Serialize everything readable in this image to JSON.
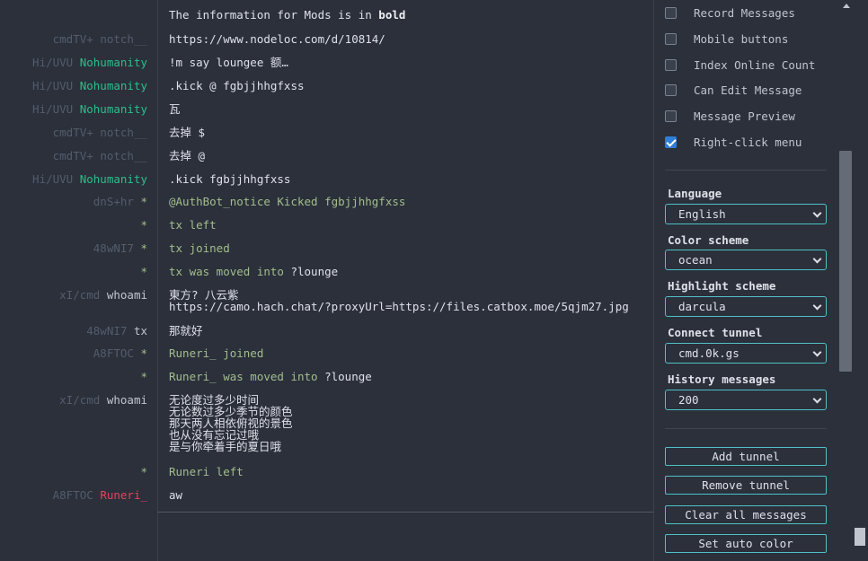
{
  "messages": [
    {
      "trip": "",
      "nick": "",
      "text_pre": "The information for Mods is in ",
      "text_bold": "bold",
      "kind": "mixed"
    },
    {
      "trip": "cmdTV+",
      "nick": "notch__",
      "nick_style": "dim",
      "text": "https://www.nodeloc.com/d/10814/",
      "kind": "normal"
    },
    {
      "trip": "Hi/UVU",
      "nick": "Nohumanity",
      "nick_style": "green",
      "text": "!m say loungee 额…",
      "kind": "normal"
    },
    {
      "trip": "Hi/UVU",
      "nick": "Nohumanity",
      "nick_style": "green",
      "text": ".kick @ fgbjjhhgfxss",
      "kind": "normal"
    },
    {
      "trip": "Hi/UVU",
      "nick": "Nohumanity",
      "nick_style": "green",
      "text": "瓦",
      "kind": "normal"
    },
    {
      "trip": "cmdTV+",
      "nick": "notch__",
      "nick_style": "dim",
      "text": "去掉 $",
      "kind": "normal"
    },
    {
      "trip": "cmdTV+",
      "nick": "notch__",
      "nick_style": "dim",
      "text": "去掉 @",
      "kind": "normal"
    },
    {
      "trip": "Hi/UVU",
      "nick": "Nohumanity",
      "nick_style": "green",
      "text": ".kick fgbjjhhgfxss",
      "kind": "normal"
    },
    {
      "trip": "dnS+hr",
      "nick": "*",
      "nick_style": "star",
      "text": "@AuthBot_notice Kicked fgbjjhhgfxss",
      "kind": "sys"
    },
    {
      "trip": "",
      "nick": "*",
      "nick_style": "star",
      "text": "tx left",
      "kind": "sys"
    },
    {
      "trip": "48wNI7",
      "nick": "*",
      "nick_style": "star",
      "text": "tx joined",
      "kind": "sys"
    },
    {
      "trip": "",
      "nick": "*",
      "nick_style": "star",
      "text_pre": "tx was moved into ",
      "text_hl": "?lounge",
      "kind": "sysmixed"
    },
    {
      "trip": "xI/cmd",
      "nick": "whoami",
      "nick_style": "normal",
      "text": "東方? 八云紫\nhttps://camo.hach.chat/?proxyUrl=https://files.catbox.moe/5qjm27.jpg",
      "kind": "normal"
    },
    {
      "trip": "48wNI7",
      "nick": "tx",
      "nick_style": "normal",
      "text": "那就好",
      "kind": "normal"
    },
    {
      "trip": "A8FTOC",
      "nick": "*",
      "nick_style": "star",
      "text": "Runeri_ joined",
      "kind": "sys"
    },
    {
      "trip": "",
      "nick": "*",
      "nick_style": "star",
      "text_pre": "Runeri_ was moved into ",
      "text_hl": "?lounge",
      "kind": "sysmixed"
    },
    {
      "trip": "xI/cmd",
      "nick": "whoami",
      "nick_style": "normal",
      "text": "无论度过多少时间\n无论数过多少季节的颜色\n那天两人相依俯视的景色\n也从没有忘记过哦\n是与你牵着手的夏日哦",
      "kind": "normal"
    },
    {
      "trip": "",
      "nick": "*",
      "nick_style": "star",
      "text": "Runeri left",
      "kind": "sys"
    },
    {
      "trip": "A8FTOC",
      "nick": "Runeri_",
      "nick_style": "red",
      "text": "aw",
      "kind": "normal"
    }
  ],
  "settings": {
    "checkboxes": [
      {
        "label": "Record Messages",
        "checked": false
      },
      {
        "label": "Mobile buttons",
        "checked": false
      },
      {
        "label": "Index Online Count",
        "checked": false
      },
      {
        "label": "Can Edit Message",
        "checked": false
      },
      {
        "label": "Message Preview",
        "checked": false
      },
      {
        "label": "Right-click menu",
        "checked": true
      }
    ],
    "selects": [
      {
        "label": "Language",
        "value": "English"
      },
      {
        "label": "Color scheme",
        "value": "ocean"
      },
      {
        "label": "Highlight scheme",
        "value": "darcula"
      },
      {
        "label": "Connect tunnel",
        "value": "cmd.0k.gs"
      },
      {
        "label": "History messages",
        "value": "200"
      }
    ],
    "buttons": [
      {
        "label": "Add tunnel"
      },
      {
        "label": "Remove tunnel"
      },
      {
        "label": "Clear all messages"
      },
      {
        "label": "Set auto color"
      }
    ]
  }
}
